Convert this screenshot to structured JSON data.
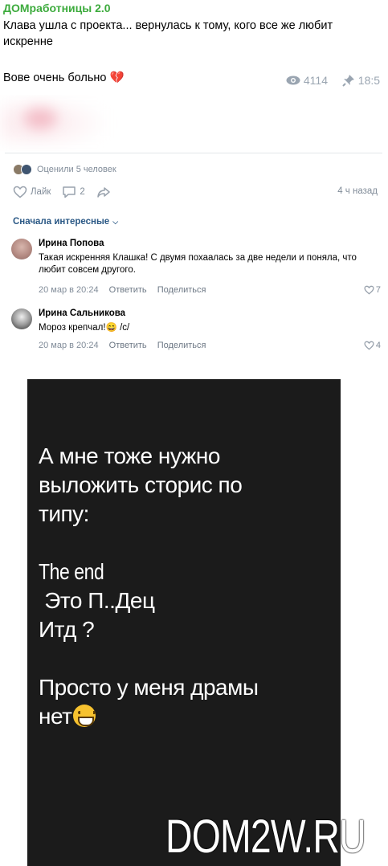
{
  "telegram": {
    "channel_name": "ДОМработницы 2.0",
    "post_text": "Клава ушла с проекта... вернулась к тому, кого все же любит искренне",
    "post_text2": "Вове очень больно 💔",
    "views": "4114",
    "time": "18:5"
  },
  "vk_post": {
    "rated_text": "Оценили 5 человек",
    "like_label": "Лайк",
    "comments_count": "2",
    "time_ago": "4 ч назад",
    "sort_label": "Сначала интересные"
  },
  "comments": [
    {
      "author": "Ирина Попова",
      "text": "Такая искренняя Клашка! С двумя похаалась за две недели и поняла, что любит совсем другого.",
      "date": "20 мар в 20:24",
      "reply_label": "Ответить",
      "share_label": "Поделиться",
      "likes": "7"
    },
    {
      "author": "Ирина Сальникова",
      "text": "Мороз крепчал!😄 /с/",
      "date": "20 мар в 20:24",
      "reply_label": "Ответить",
      "share_label": "Поделиться",
      "likes": "4"
    }
  ],
  "story": {
    "line1": "А мне тоже нужно",
    "line2": "выложить сторис по",
    "line3": "типу:",
    "line4": "The end",
    "line5": " Это П..Дец",
    "line6": "Итд ?",
    "line7": "Просто у меня драмы",
    "line8": "нет"
  },
  "watermark": "DOM2W.RU",
  "colors": {
    "channel_green": "#3dab3d",
    "vk_link": "#2a5885",
    "muted": "#818c99",
    "story_bg": "#1b1b1b"
  }
}
